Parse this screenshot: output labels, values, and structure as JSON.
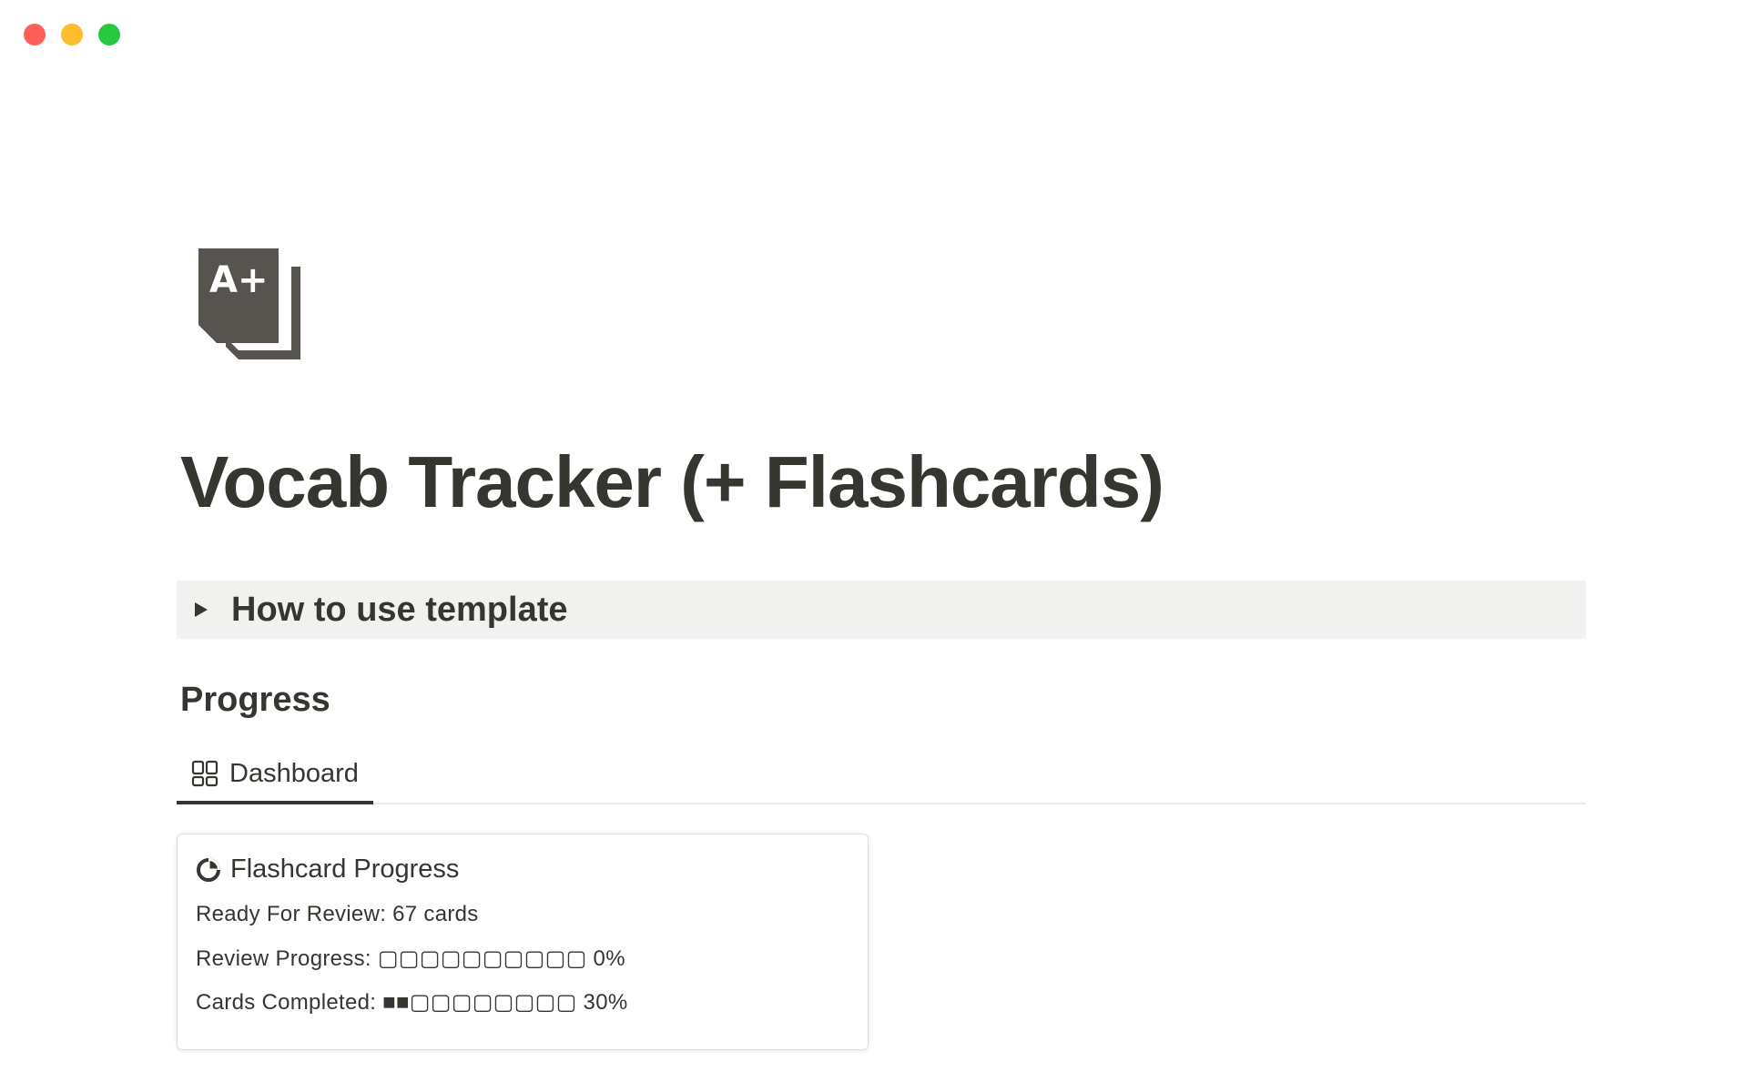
{
  "window": {
    "controls": [
      "close",
      "minimize",
      "maximize"
    ]
  },
  "page": {
    "icon": "a-plus-document-icon",
    "title": "Vocab Tracker (+ Flashcards)"
  },
  "toggle": {
    "label": "How to use template",
    "expanded": false
  },
  "section": {
    "heading": "Progress"
  },
  "tabs": [
    {
      "label": "Dashboard",
      "icon": "gallery-grid-icon",
      "active": true
    }
  ],
  "card": {
    "icon": "pie-chart-icon",
    "title": "Flashcard Progress",
    "ready_for_review": "Ready For Review: 67 cards",
    "review_progress": "Review Progress: ▢▢▢▢▢▢▢▢▢▢ 0%",
    "cards_completed": "Cards Completed: ■■▢▢▢▢▢▢▢▢ 30%"
  },
  "colors": {
    "text": "#37352f",
    "toggle_bg": "#f1f1ef",
    "close": "#ff5f57",
    "minimize": "#febc2e",
    "maximize": "#28c840"
  }
}
